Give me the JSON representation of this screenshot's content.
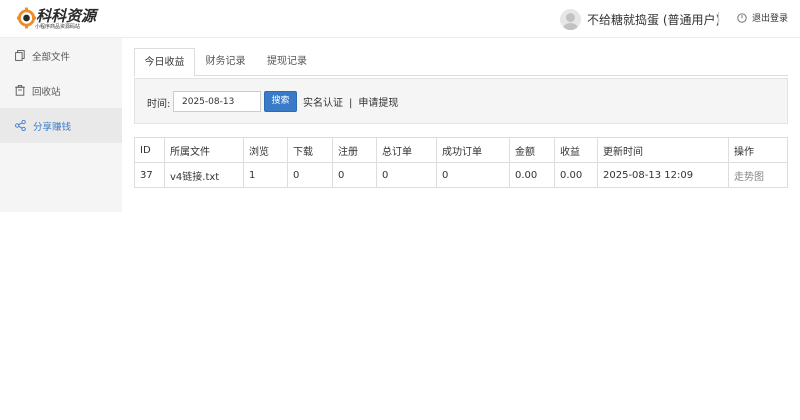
{
  "logo": {
    "title": "科科资源",
    "subtitle": "小程序商品资源码站"
  },
  "user": {
    "name": "不给糖就捣蛋 (普通用户)",
    "logout_label": "退出登录"
  },
  "sidebar": {
    "items": [
      {
        "label": "全部文件",
        "icon": "files-icon"
      },
      {
        "label": "回收站",
        "icon": "trash-icon"
      },
      {
        "label": "分享赚钱",
        "icon": "share-icon",
        "active": true
      }
    ]
  },
  "tabs": [
    {
      "label": "今日收益",
      "active": true
    },
    {
      "label": "财务记录"
    },
    {
      "label": "提现记录"
    }
  ],
  "filter": {
    "time_label": "时间:",
    "date_value": "2025-08-13",
    "search_label": "搜索",
    "verify_link": "实名认证",
    "divider": "|",
    "withdraw_link": "申请提现"
  },
  "table": {
    "columns": [
      "ID",
      "所属文件",
      "浏览",
      "下载",
      "注册",
      "总订单",
      "成功订单",
      "金额",
      "收益",
      "更新时间",
      "操作"
    ],
    "rows": [
      [
        "37",
        "v4链接.txt",
        "1",
        "0",
        "0",
        "0",
        "0",
        "0.00",
        "0.00",
        "2025-08-13 12:09",
        "走势图"
      ]
    ]
  },
  "colors": {
    "accent": "#3a7bc8",
    "logo_orange": "#f08a24"
  }
}
